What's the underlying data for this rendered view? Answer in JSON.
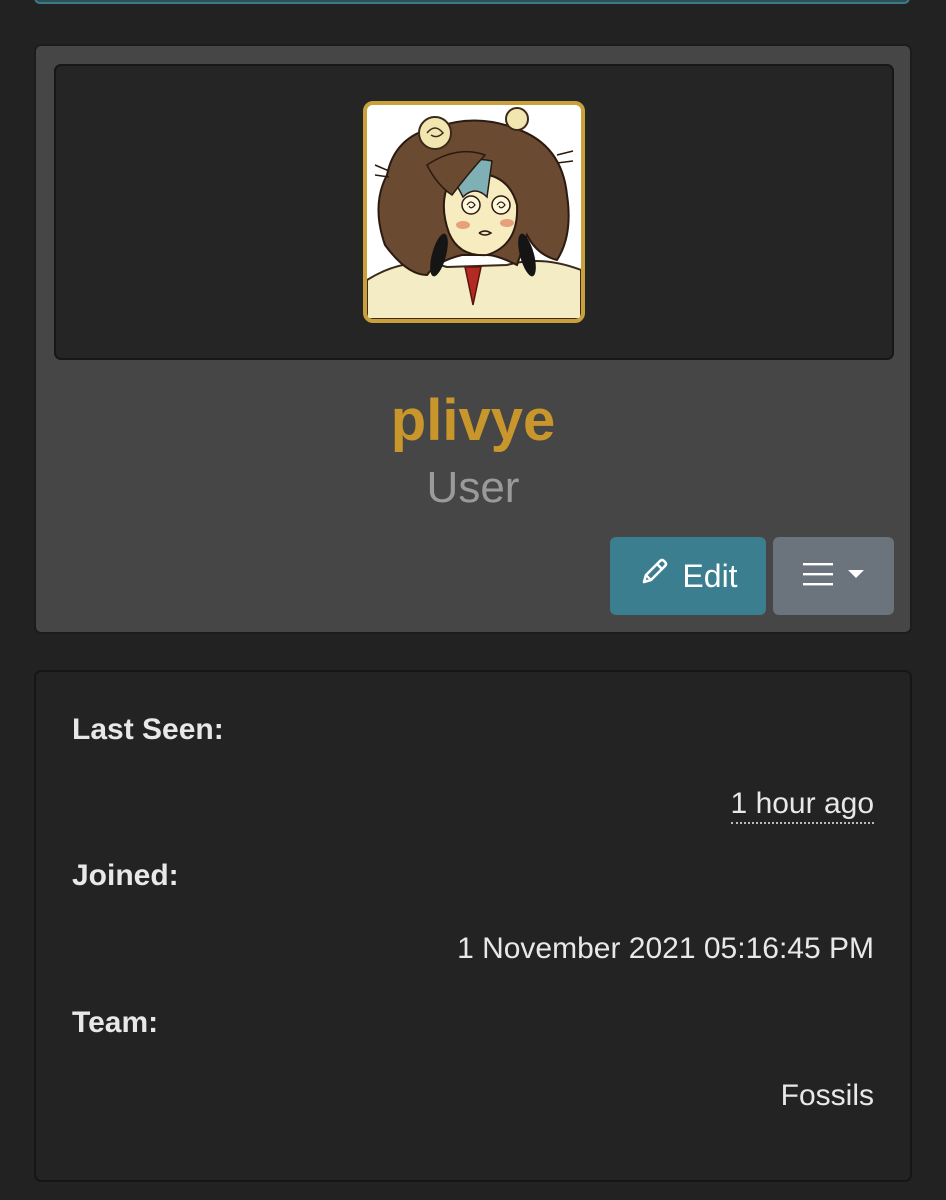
{
  "profile": {
    "username": "plivye",
    "role": "User",
    "colors": {
      "username": "#c9962b",
      "avatar_border": "#c9a03a",
      "edit_button": "#3a7e8f",
      "menu_button": "#6b737d"
    }
  },
  "actions": {
    "edit_label": "Edit",
    "edit_icon": "pencil-icon",
    "menu_icon": "hamburger-icon",
    "menu_caret_icon": "caret-down-icon"
  },
  "details": {
    "last_seen_label": "Last Seen:",
    "last_seen_value": "1 hour ago",
    "joined_label": "Joined:",
    "joined_value": "1 November 2021 05:16:45 PM",
    "team_label": "Team:",
    "team_value": "Fossils"
  }
}
